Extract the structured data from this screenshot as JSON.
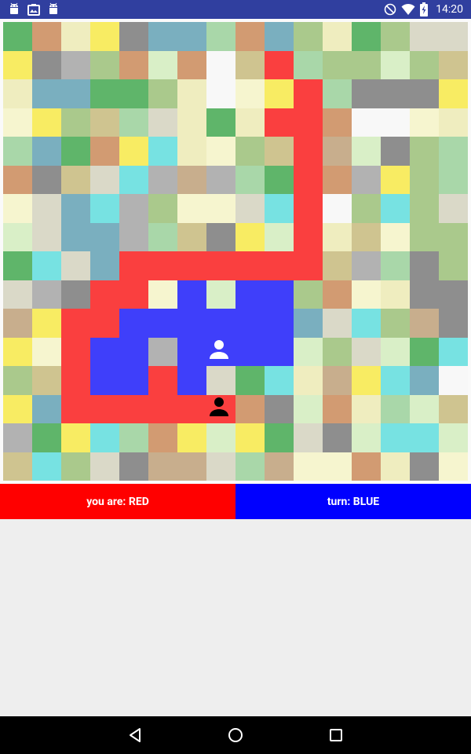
{
  "status_bar": {
    "time": "14:20",
    "left_icons": [
      "android-icon",
      "screenshot-icon",
      "android-icon"
    ],
    "right_icons": [
      "do-not-disturb-icon",
      "wifi-icon",
      "battery-charging-icon"
    ],
    "bg": "#303f9f"
  },
  "board": {
    "cols": 16,
    "rows": 16,
    "palette": {
      "a": "#5fb56a",
      "b": "#d29b72",
      "c": "#efedbf",
      "d": "#f8ec63",
      "e": "#8e8e8e",
      "f": "#7aafbf",
      "g": "#a9d7a9",
      "h": "#aac98c",
      "i": "#dad9c8",
      "j": "#b2b2b2",
      "k": "#d9efc7",
      "l": "#f8f8f8",
      "m": "#cfc490",
      "n": "#77e2e2",
      "o": "#c8ae8d",
      "p": "#f6f5cf",
      "R": "#fa3f3f",
      "B": "#3f3ffa"
    },
    "grid": [
      "abcdeffgbfhcahii",
      "dejhbkblmRghhkhm",
      "cffaahclpdRgeeed",
      "pdhmgicacRRbllpc",
      "gfabdncphmRokehg",
      "beminjojgaRbjdhg",
      "pifnjhppinRlhnhi",
      "kiffjgmedkRcmphh",
      "anifRRRRRRRmjgeh",
      "ijeRRpBkBBhbpcee",
      "odRRBBBBBBfinhoe",
      "dpRBBjBBBBkhikan",
      "hmRBBRBiancodnfl",
      "dfRRRRRRbekbcgkm",
      "jadngbdkdaieknnk",
      "mnhieooigoppbcep"
    ]
  },
  "pieces": {
    "blue_label": "blue-player-piece",
    "red_label": "red-player-piece"
  },
  "info": {
    "you_are": "you are: RED",
    "turn": "turn: BLUE",
    "you_are_color": "#ff0000",
    "turn_color": "#0000ff"
  },
  "nav": {
    "buttons": [
      "back-icon",
      "home-icon",
      "recents-icon"
    ]
  }
}
